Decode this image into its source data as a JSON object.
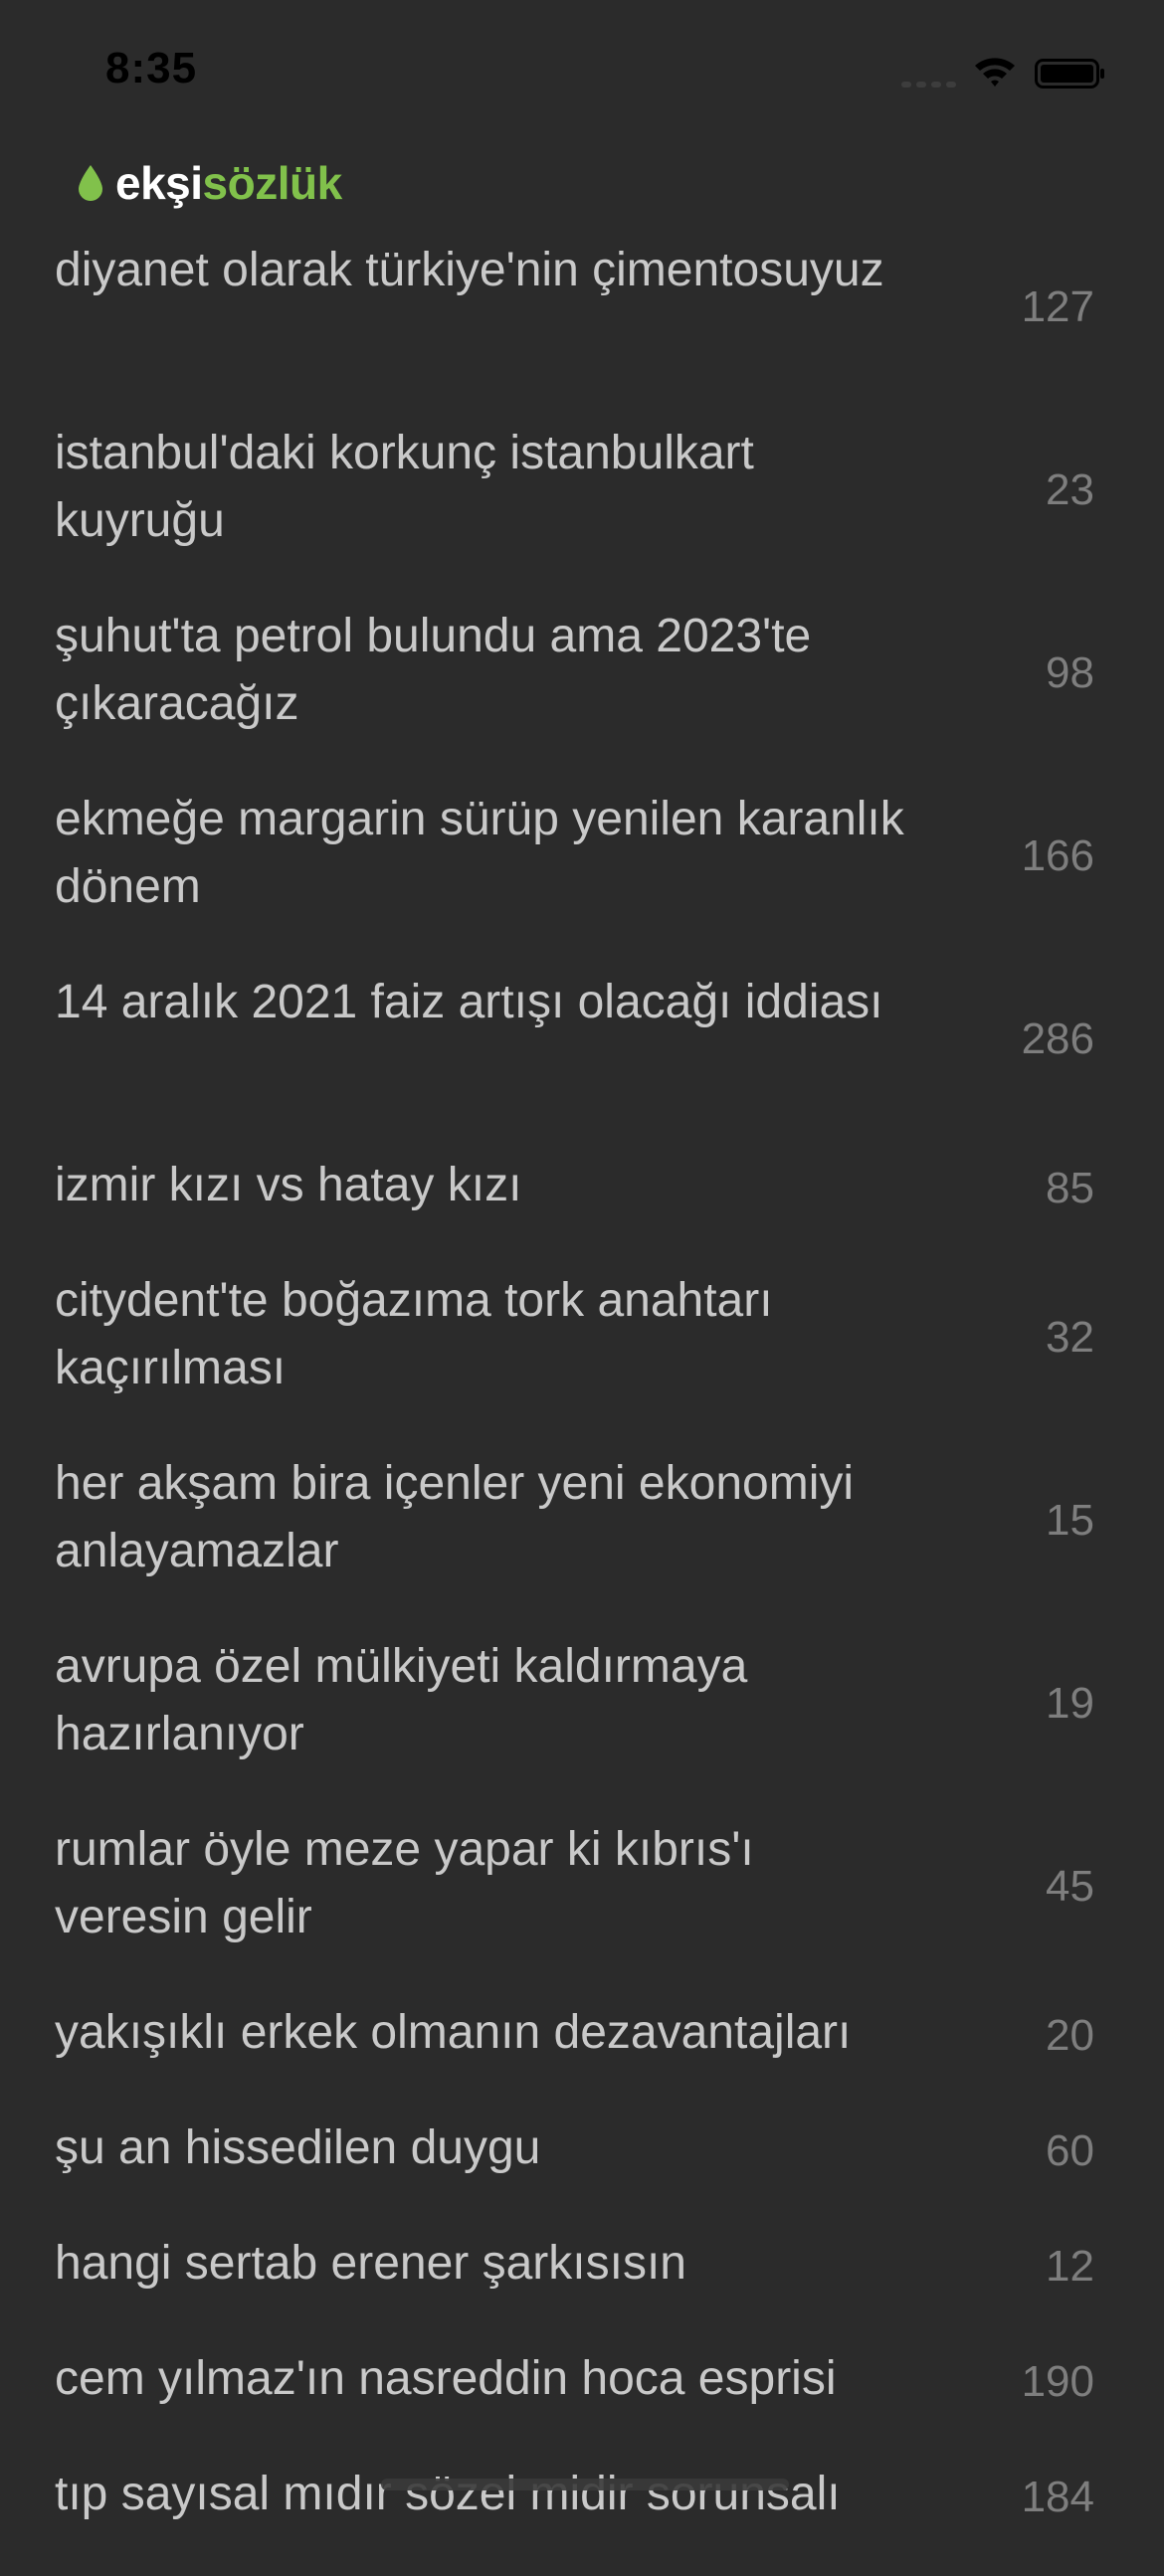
{
  "status_bar": {
    "time": "8:35"
  },
  "header": {
    "logo_part1": "ekşi",
    "logo_part2": "sözlük"
  },
  "topics": [
    {
      "title": "diyanet olarak türkiye'nin çimentosuyuz",
      "count": "127"
    },
    {
      "title": "istanbul'daki korkunç istanbulkart kuyruğu",
      "count": "23"
    },
    {
      "title": "şuhut'ta petrol bulundu ama 2023'te çıkaracağız",
      "count": "98"
    },
    {
      "title": "ekmeğe margarin sürüp yenilen karanlık dönem",
      "count": "166"
    },
    {
      "title": "14 aralık 2021 faiz artışı olacağı iddiası",
      "count": "286"
    },
    {
      "title": "izmir kızı vs hatay kızı",
      "count": "85"
    },
    {
      "title": "citydent'te boğazıma tork anahtarı kaçırılması",
      "count": "32"
    },
    {
      "title": "her akşam bira içenler yeni ekonomiyi anlayamazlar",
      "count": "15"
    },
    {
      "title": "avrupa özel mülkiyeti kaldırmaya hazırlanıyor",
      "count": "19"
    },
    {
      "title": "rumlar öyle meze yapar ki kıbrıs'ı veresin gelir",
      "count": "45"
    },
    {
      "title": "yakışıklı erkek olmanın dezavantajları",
      "count": "20"
    },
    {
      "title": "şu an hissedilen duygu",
      "count": "60"
    },
    {
      "title": "hangi sertab erener şarkısısın",
      "count": "12"
    },
    {
      "title": "cem yılmaz'ın nasreddin hoca esprisi",
      "count": "190"
    },
    {
      "title": "tıp sayısal mıdır sözel midir sorunsalı",
      "count": "184"
    }
  ],
  "colors": {
    "background": "#2b2b2b",
    "accent": "#81c14b",
    "title_text": "#c9c9c9",
    "count_text": "#7e7e7e"
  }
}
